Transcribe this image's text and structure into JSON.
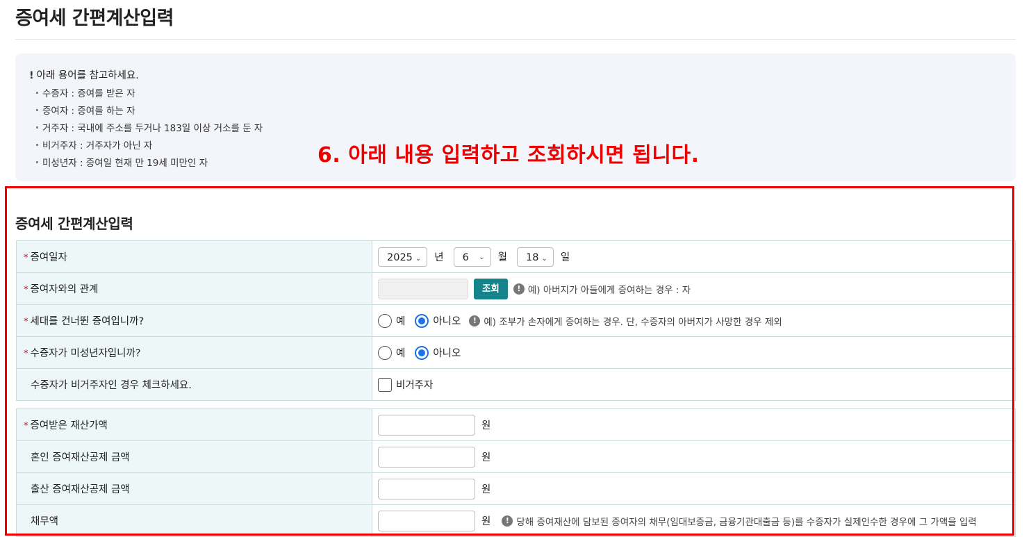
{
  "page": {
    "title": "증여세 간편계산입력"
  },
  "notes": {
    "heading": "아래 용어를 참고하세요.",
    "items": [
      "수증자 : 증여를 받은 자",
      "증여자 : 증여를 하는 자",
      "거주자 : 국내에 주소를 두거나 183일 이상 거소를 둔 자",
      "비거주자 : 거주자가 아닌 자",
      "미성년자 : 증여일 현재 만 19세 미만인 자"
    ]
  },
  "annotation": "6. 아래 내용 입력하고 조회하시면 됩니다.",
  "form": {
    "title": "증여세 간편계산입력",
    "required_mark": "*",
    "gift_date": {
      "label": "증여일자",
      "year": "2025",
      "year_unit": "년",
      "month": "6",
      "month_unit": "월",
      "day": "18",
      "day_unit": "일"
    },
    "relationship": {
      "label": "증여자와의 관계",
      "value": "",
      "button": "조회",
      "hint": "예) 아버지가 아들에게 증여하는 경우 : 자"
    },
    "skip_generation": {
      "label": "세대를 건너뛴 증여입니까?",
      "options": [
        "예",
        "아니오"
      ],
      "selected": "아니오",
      "hint": "예) 조부가 손자에게 증여하는 경우. 단, 수증자의 아버지가 사망한 경우 제외"
    },
    "minor": {
      "label": "수증자가 미성년자입니까?",
      "options": [
        "예",
        "아니오"
      ],
      "selected": "아니오"
    },
    "non_resident": {
      "label": "수증자가 비거주자인 경우 체크하세요.",
      "checkbox_label": "비거주자",
      "checked": false
    },
    "gift_amount": {
      "label": "증여받은 재산가액",
      "value": "",
      "unit": "원"
    },
    "marriage_deduction": {
      "label": "혼인 증여재산공제 금액",
      "value": "",
      "unit": "원"
    },
    "birth_deduction": {
      "label": "출산 증여재산공제 금액",
      "value": "",
      "unit": "원"
    },
    "debt": {
      "label": "채무액",
      "value": "",
      "unit": "원",
      "hint": "당해 증여재산에 담보된 증여자의 채무(임대보증금, 금융기관대출금 등)를 수증자가 실제인수한 경우에 그 가액을 입력"
    }
  },
  "colors": {
    "annotation": "#ee0000",
    "button": "#14848a",
    "label_bg": "#eef7f7",
    "radio_selected": "#1a73e8"
  }
}
